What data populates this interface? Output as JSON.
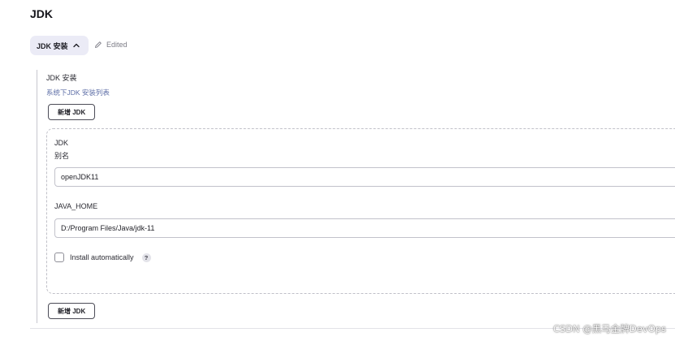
{
  "section": {
    "title": "JDK"
  },
  "toggle": {
    "label": "JDK 安装",
    "icon": "chevron-up-icon"
  },
  "status": {
    "edited_label": "Edited",
    "icon": "pencil-icon"
  },
  "group": {
    "heading": "JDK 安装",
    "description": "系统下JDK 安装列表",
    "add_label_top": "新增 JDK",
    "add_label_bottom": "新增 JDK"
  },
  "installation": {
    "title": "JDK",
    "alias_label": "别名",
    "alias_value": "openJDK11",
    "home_label": "JAVA_HOME",
    "home_value": "D:/Program Files/Java/jdk-11",
    "auto_install_label": "Install automatically",
    "auto_install_checked": false,
    "help_glyph": "?"
  },
  "watermark": {
    "text": "CSDN @黑马金牌DevOps"
  },
  "colors": {
    "toggle_bg": "#ebebf6",
    "description_text": "#5c6da6",
    "border": "#c2c2cb"
  }
}
